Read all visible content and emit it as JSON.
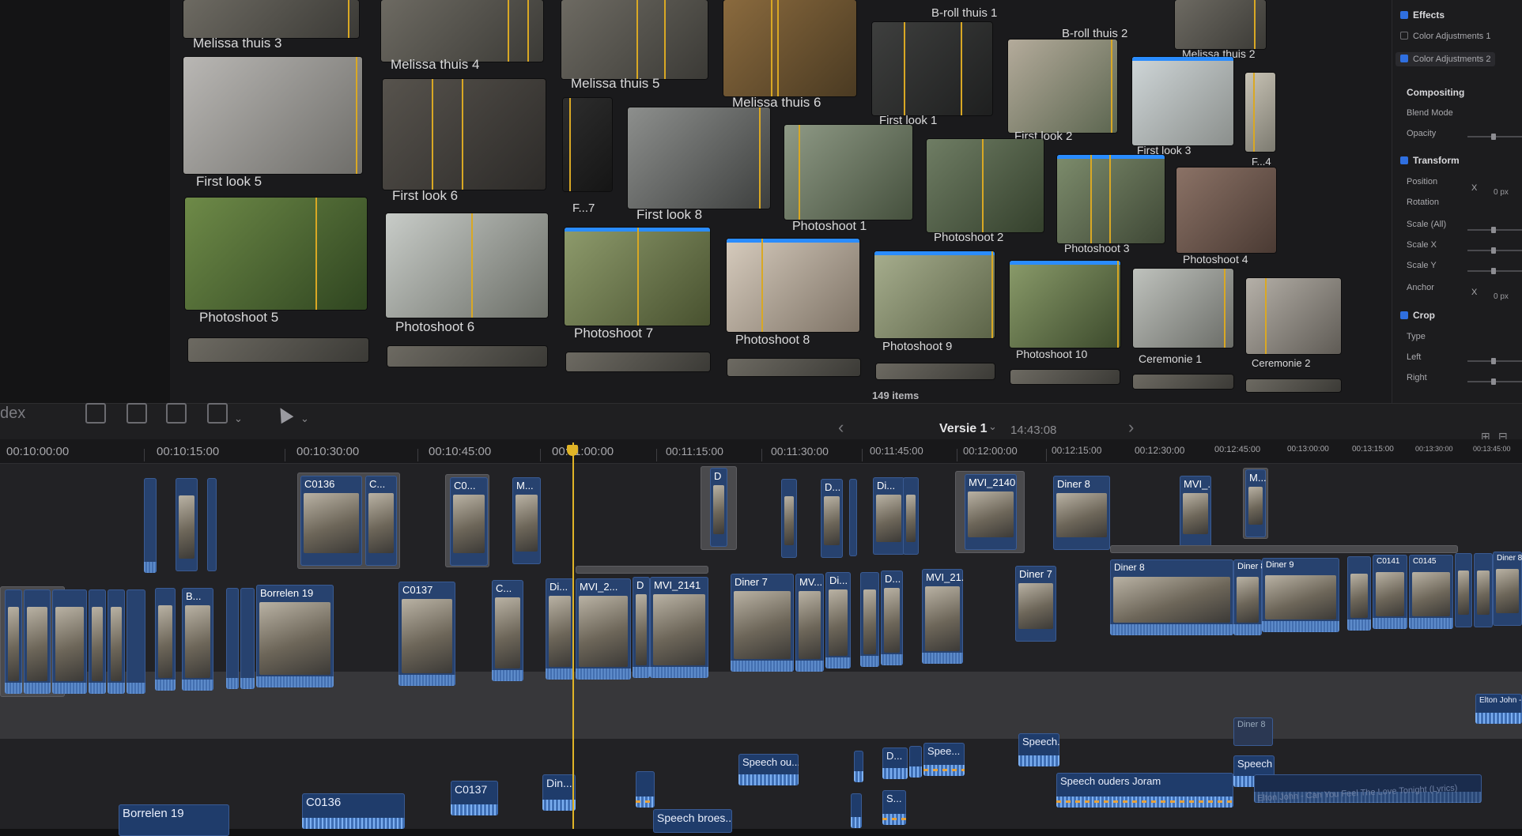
{
  "browser": {
    "clips": [
      {
        "label": "Melissa thuis 3"
      },
      {
        "label": "Melissa thuis 4"
      },
      {
        "label": "Melissa thuis 5"
      },
      {
        "label": "Melissa thuis 6"
      },
      {
        "label": "B-roll thuis 1"
      },
      {
        "label": "B-roll thuis 2"
      },
      {
        "label": "Melissa thuis 2"
      },
      {
        "label": "First look 1"
      },
      {
        "label": "First look 2"
      },
      {
        "label": "First look 3"
      },
      {
        "label": "F...4"
      },
      {
        "label": "First look 5"
      },
      {
        "label": "First look 6"
      },
      {
        "label": "F...7"
      },
      {
        "label": "First look 8"
      },
      {
        "label": "Photoshoot 1"
      },
      {
        "label": "Photoshoot 2"
      },
      {
        "label": "Photoshoot 3"
      },
      {
        "label": "Photoshoot 4"
      },
      {
        "label": "Photoshoot 5"
      },
      {
        "label": "Photoshoot 6"
      },
      {
        "label": "Photoshoot 7"
      },
      {
        "label": "Photoshoot 8"
      },
      {
        "label": "Photoshoot 9"
      },
      {
        "label": "Photoshoot 10"
      },
      {
        "label": "Ceremonie 1"
      },
      {
        "label": "Ceremonie 2"
      }
    ],
    "item_count": "149 items"
  },
  "inspector": {
    "effects": "Effects",
    "color_adj_1": "Color Adjustments 1",
    "color_adj_2": "Color Adjustments 2",
    "compositing": "Compositing",
    "blend_mode": "Blend Mode",
    "opacity": "Opacity",
    "transform": "Transform",
    "position": "Position",
    "position_x": "X",
    "position_val": "0 px",
    "rotation": "Rotation",
    "scale_all": "Scale (All)",
    "scale_x": "Scale X",
    "scale_y": "Scale Y",
    "anchor": "Anchor",
    "anchor_x": "X",
    "anchor_val": "0 px",
    "crop": "Crop",
    "type": "Type",
    "left": "Left",
    "right": "Right"
  },
  "toolbar": {
    "index_label": "dex",
    "project_name": "Versie 1",
    "duration": "14:43:08"
  },
  "ruler": {
    "timecodes": [
      "00:10:00:00",
      "00:10:15:00",
      "00:10:30:00",
      "00:10:45:00",
      "00:11:00:00",
      "00:11:15:00",
      "00:11:30:00",
      "00:11:45:00",
      "00:12:00:00",
      "00:12:15:00",
      "00:12:30:00",
      "00:12:45:00",
      "00:13:00:00",
      "00:13:15:00",
      "00:13:30:00",
      "00:13:45:00"
    ]
  },
  "timeline": {
    "upper_clips": [
      "C0136",
      "C...",
      "C0...",
      "M...",
      "D",
      "D...",
      "Di...",
      "MVI_2140",
      "Diner 8",
      "MVI_...",
      "M..."
    ],
    "main_clips": [
      "Borrelen 19",
      "C0137",
      "C...",
      "Di...",
      "MVI_2...",
      "D",
      "MVI_2141",
      "Diner 7",
      "MV...",
      "Di...",
      "D...",
      "MVI_21...",
      "Diner 7",
      "Diner 8",
      "Diner 8",
      "Diner 9",
      "C0141",
      "C0145",
      "Diner 8",
      "B..."
    ],
    "audio_clips": [
      "Speech ou...",
      "D...",
      "Spee...",
      "Speech...",
      "Speech ouders Joram",
      "Speech o...",
      "Diner 8",
      "Borrelen 19",
      "C0136",
      "C0137",
      "Din...",
      "Speech broes...",
      "S...",
      "Elton John - Can"
    ],
    "credit": "Elton John - Can You Feel The Love Tonight (Lyrics)"
  }
}
